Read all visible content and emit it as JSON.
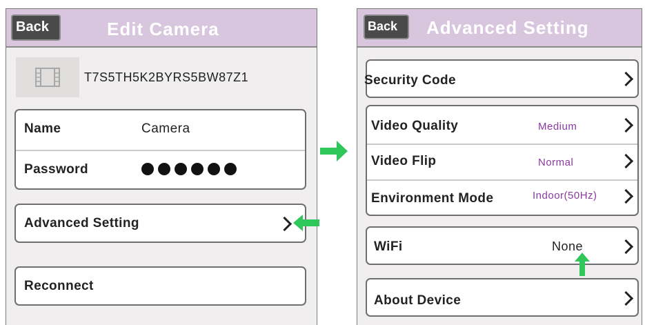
{
  "left_screen": {
    "back_label": "Back",
    "title": "Edit Camera",
    "camera_id": "T7S5TH5K2BYRS5BW87Z1",
    "name_label": "Name",
    "name_value": "Camera",
    "password_label": "Password",
    "advanced_label": "Advanced Setting",
    "reconnect_label": "Reconnect"
  },
  "right_screen": {
    "back_label": "Back",
    "title": "Advanced Setting",
    "security_code_label": "Security Code",
    "video_quality_label": "Video Quality",
    "video_quality_value": "Medium",
    "video_flip_label": "Video Flip",
    "video_flip_value": "Normal",
    "environment_mode_label": "Environment Mode",
    "environment_mode_value": "Indoor(50Hz)",
    "wifi_label": "WiFi",
    "wifi_value": "None",
    "about_label": "About Device"
  },
  "colors": {
    "header": "#d8c6de",
    "back_button": "#4b4a4a",
    "value_purple": "#8a3aa0",
    "arrow_green": "#2fc65a"
  },
  "icons": [
    "film-strip-icon",
    "chevron-right-icon",
    "green-arrow-icon",
    "password-dot-icon"
  ]
}
